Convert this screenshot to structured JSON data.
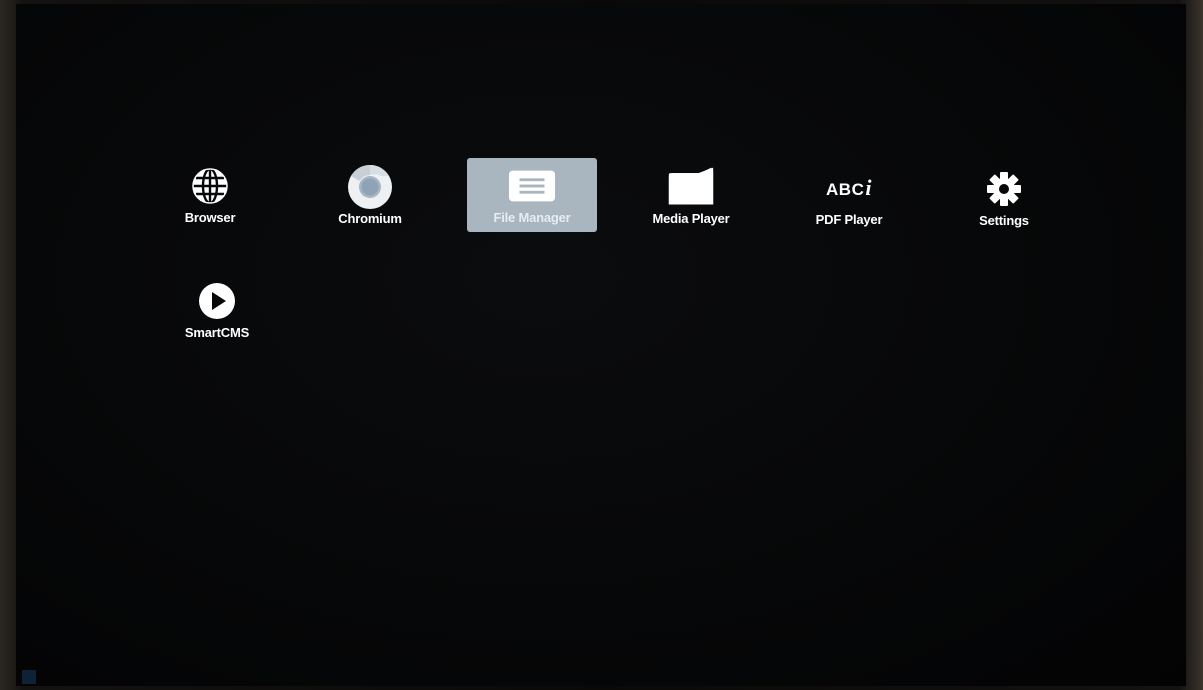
{
  "launcher": {
    "apps": [
      {
        "label": "Browser",
        "icon": "globe-icon",
        "selected": false
      },
      {
        "label": "Chromium",
        "icon": "chromium-icon",
        "selected": false
      },
      {
        "label": "File Manager",
        "icon": "file-manager-icon",
        "selected": true
      },
      {
        "label": "Media Player",
        "icon": "folder-icon",
        "selected": false
      },
      {
        "label": "PDF Player",
        "icon": "abc-icon",
        "icon_text": "ABC",
        "icon_text_italic": "i",
        "selected": false
      },
      {
        "label": "Settings",
        "icon": "gear-icon",
        "selected": false
      },
      {
        "label": "SmartCMS",
        "icon": "play-icon",
        "selected": false
      }
    ]
  },
  "colors": {
    "background": "#050607",
    "selected_tile": "#a9b5bf",
    "label": "#ffffff"
  }
}
